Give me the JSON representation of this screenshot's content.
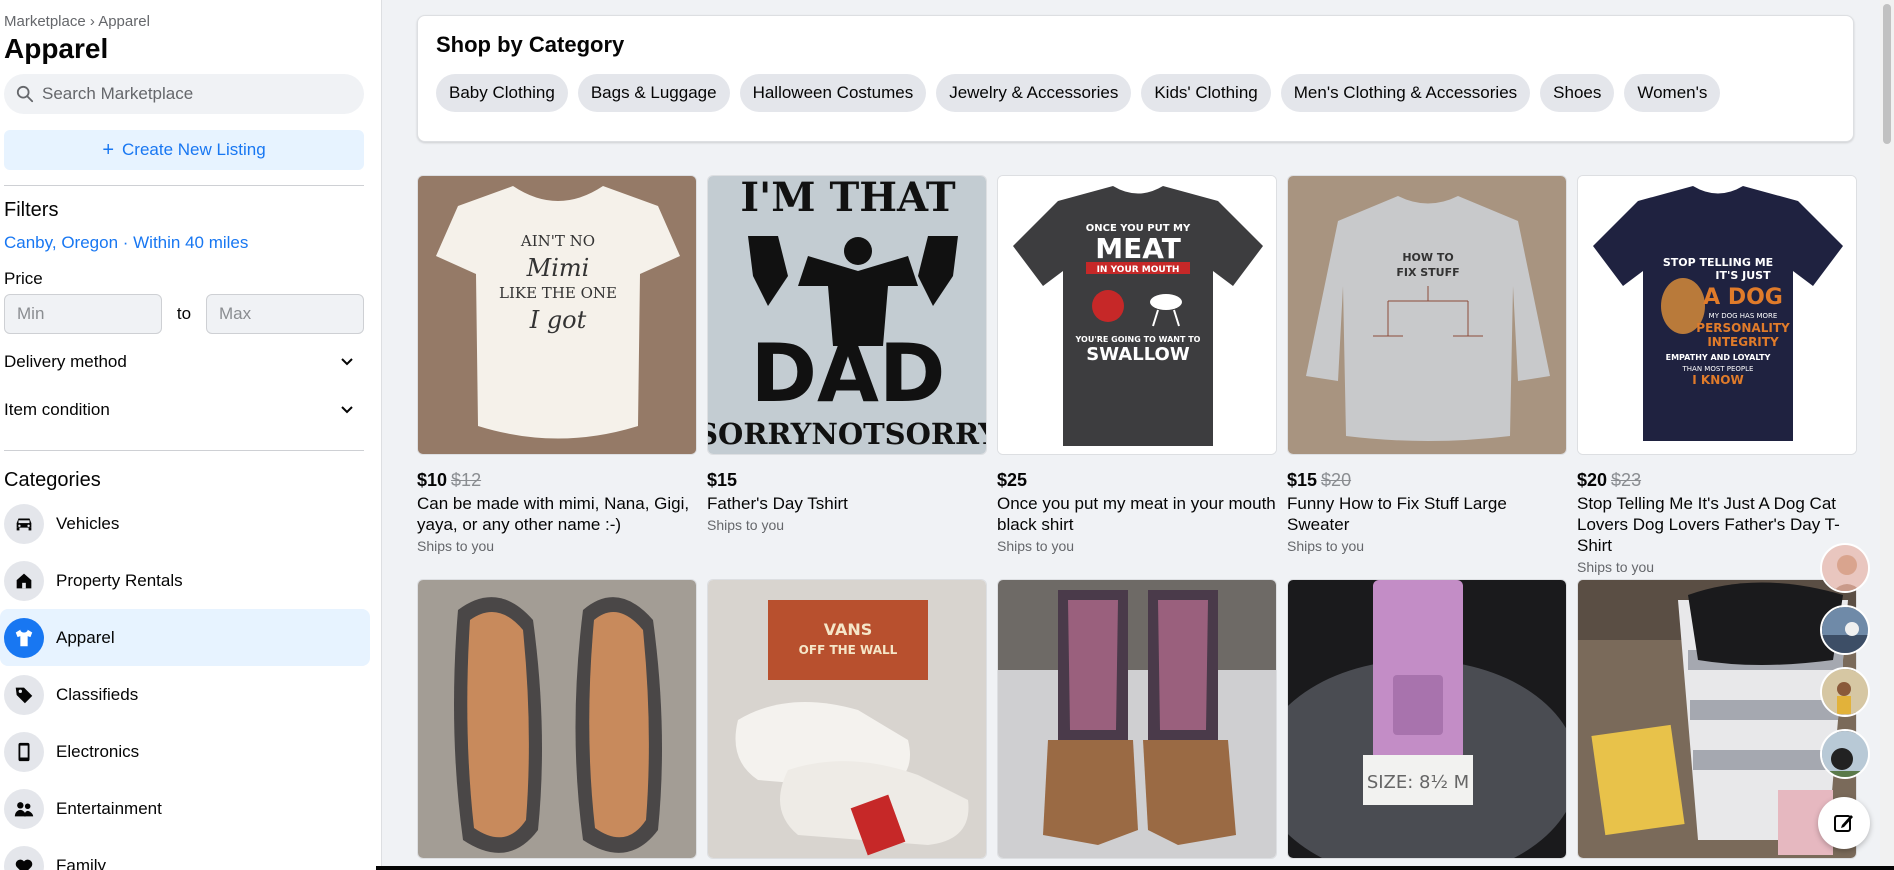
{
  "breadcrumb": "Marketplace › Apparel",
  "page_title": "Apparel",
  "search": {
    "placeholder": "Search Marketplace"
  },
  "create_listing_label": "Create New Listing",
  "filters": {
    "title": "Filters",
    "location": "Canby, Oregon · Within 40 miles",
    "price_label": "Price",
    "min_placeholder": "Min",
    "max_placeholder": "Max",
    "to_label": "to",
    "delivery_label": "Delivery method",
    "condition_label": "Item condition"
  },
  "categories": {
    "title": "Categories",
    "items": [
      {
        "label": "Vehicles",
        "icon": "car-icon"
      },
      {
        "label": "Property Rentals",
        "icon": "house-icon"
      },
      {
        "label": "Apparel",
        "icon": "shirt-icon",
        "active": true
      },
      {
        "label": "Classifieds",
        "icon": "tag-icon"
      },
      {
        "label": "Electronics",
        "icon": "phone-icon"
      },
      {
        "label": "Entertainment",
        "icon": "people-icon"
      },
      {
        "label": "Family",
        "icon": "heart-icon"
      }
    ]
  },
  "shop": {
    "title": "Shop by Category",
    "chips": [
      "Baby Clothing",
      "Bags & Luggage",
      "Halloween Costumes",
      "Jewelry & Accessories",
      "Kids' Clothing",
      "Men's Clothing & Accessories",
      "Shoes",
      "Women's"
    ]
  },
  "listings": [
    {
      "price": "$10",
      "orig": "$12",
      "title": "Can be made with mimi, Nana, Gigi, yaya, or any other name :-)",
      "ships": "Ships to you",
      "image": "baby-onesie",
      "image_text": [
        "AIN'T NO",
        "Mimi",
        "LIKE THE ONE",
        "I got"
      ]
    },
    {
      "price": "$15",
      "orig": "",
      "title": "Father's Day Tshirt",
      "ships": "Ships to you",
      "image": "dad-shirt",
      "image_text": [
        "I'M THAT",
        "DAD",
        "SORRYNOTSORRY"
      ]
    },
    {
      "price": "$25",
      "orig": "",
      "title": "Once you put my meat in your mouth black shirt",
      "ships": "Ships to you",
      "image": "meat-shirt",
      "image_text": [
        "ONCE YOU PUT MY",
        "MEAT",
        "IN YOUR MOUTH",
        "YOU'RE GOING TO WANT TO",
        "SWALLOW"
      ]
    },
    {
      "price": "$15",
      "orig": "$20",
      "title": "Funny How to Fix Stuff Large Sweater",
      "ships": "Ships to you",
      "image": "sweater",
      "image_text": [
        "HOW TO",
        "FIX STUFF"
      ]
    },
    {
      "price": "$20",
      "orig": "$23",
      "title": "Stop Telling Me It's Just A Dog Cat Lovers Dog Lovers Father's Day T-Shirt",
      "ships": "Ships to you",
      "image": "dog-shirt",
      "image_text": [
        "STOP TELLING ME",
        "IT'S JUST",
        "A DOG",
        "MY DOG HAS MORE",
        "PERSONALITY",
        "INTEGRITY",
        "EMPATHY AND LOYALTY",
        "THAN MOST PEOPLE",
        "I KNOW"
      ]
    },
    {
      "image": "vans-soles"
    },
    {
      "image": "vans-white",
      "image_text": [
        "VANS",
        "OFF THE WALL"
      ]
    },
    {
      "image": "cowgirl-boots"
    },
    {
      "image": "purple-shoe",
      "image_text": [
        "SIZE: 8½ M"
      ]
    },
    {
      "image": "basket-items"
    }
  ],
  "colors": {
    "accent": "#1877f2",
    "accent_bg": "#e7f3ff",
    "chip_bg": "#e4e6eb",
    "page_bg": "#f0f2f5"
  }
}
